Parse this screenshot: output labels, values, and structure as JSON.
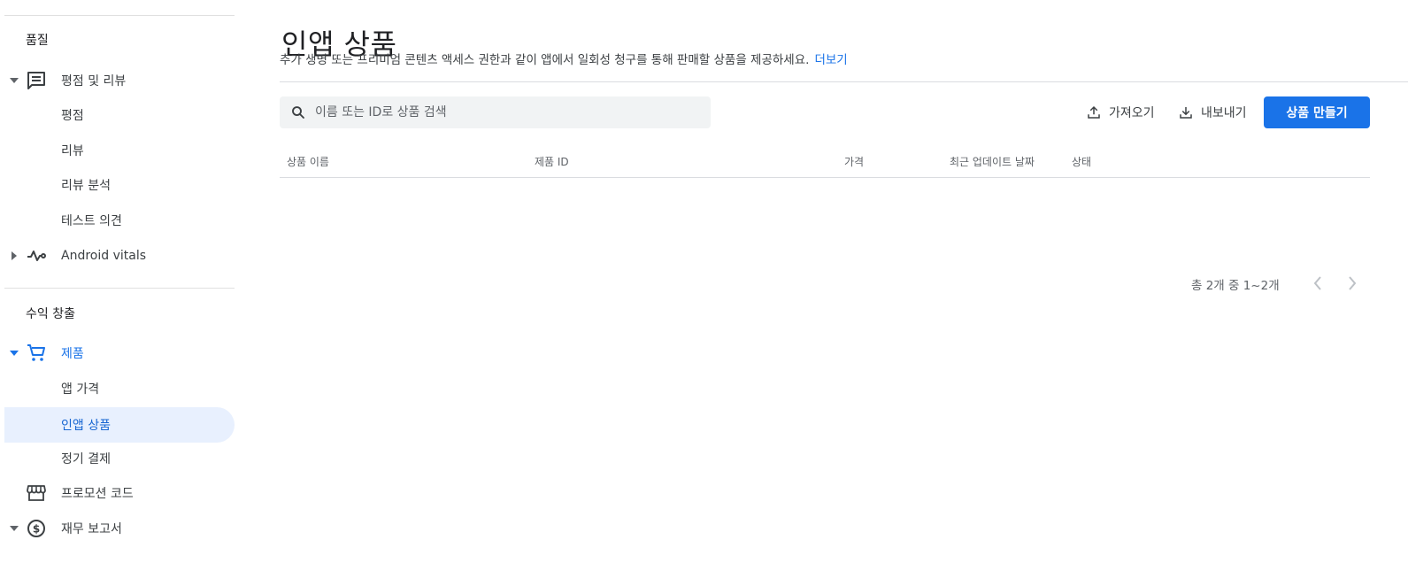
{
  "sidebar": {
    "quality_section": "품질",
    "ratings_reviews": "평점 및 리뷰",
    "ratings": "평점",
    "reviews": "리뷰",
    "review_analysis": "리뷰 분석",
    "test_feedback": "테스트 의견",
    "android_vitals": "Android vitals",
    "monetize_section": "수익 창출",
    "products": "제품",
    "app_pricing": "앱 가격",
    "in_app_products": "인앱 상품",
    "subscriptions": "정기 결제",
    "promo_codes": "프로모션 코드",
    "financial_reports": "재무 보고서"
  },
  "page": {
    "title": "인앱 상품",
    "description": "추가 생명 또는 프리미엄 콘텐츠 액세스 권한과 같이 앱에서 일회성 청구를 통해 판매할 상품을 제공하세요.",
    "learn_more": "더보기"
  },
  "search": {
    "placeholder": "이름 또는 ID로 상품 검색"
  },
  "toolbar": {
    "import_label": "가져오기",
    "export_label": "내보내기",
    "create_label": "상품 만들기"
  },
  "table": {
    "columns": [
      "상품 이름",
      "제품 ID",
      "가격",
      "최근 업데이트 날짜",
      "상태"
    ]
  },
  "pagination": {
    "summary": "총 2개 중 1~2개"
  },
  "colors": {
    "accent": "#1a73e8",
    "active_bg": "#e8f0fe"
  }
}
